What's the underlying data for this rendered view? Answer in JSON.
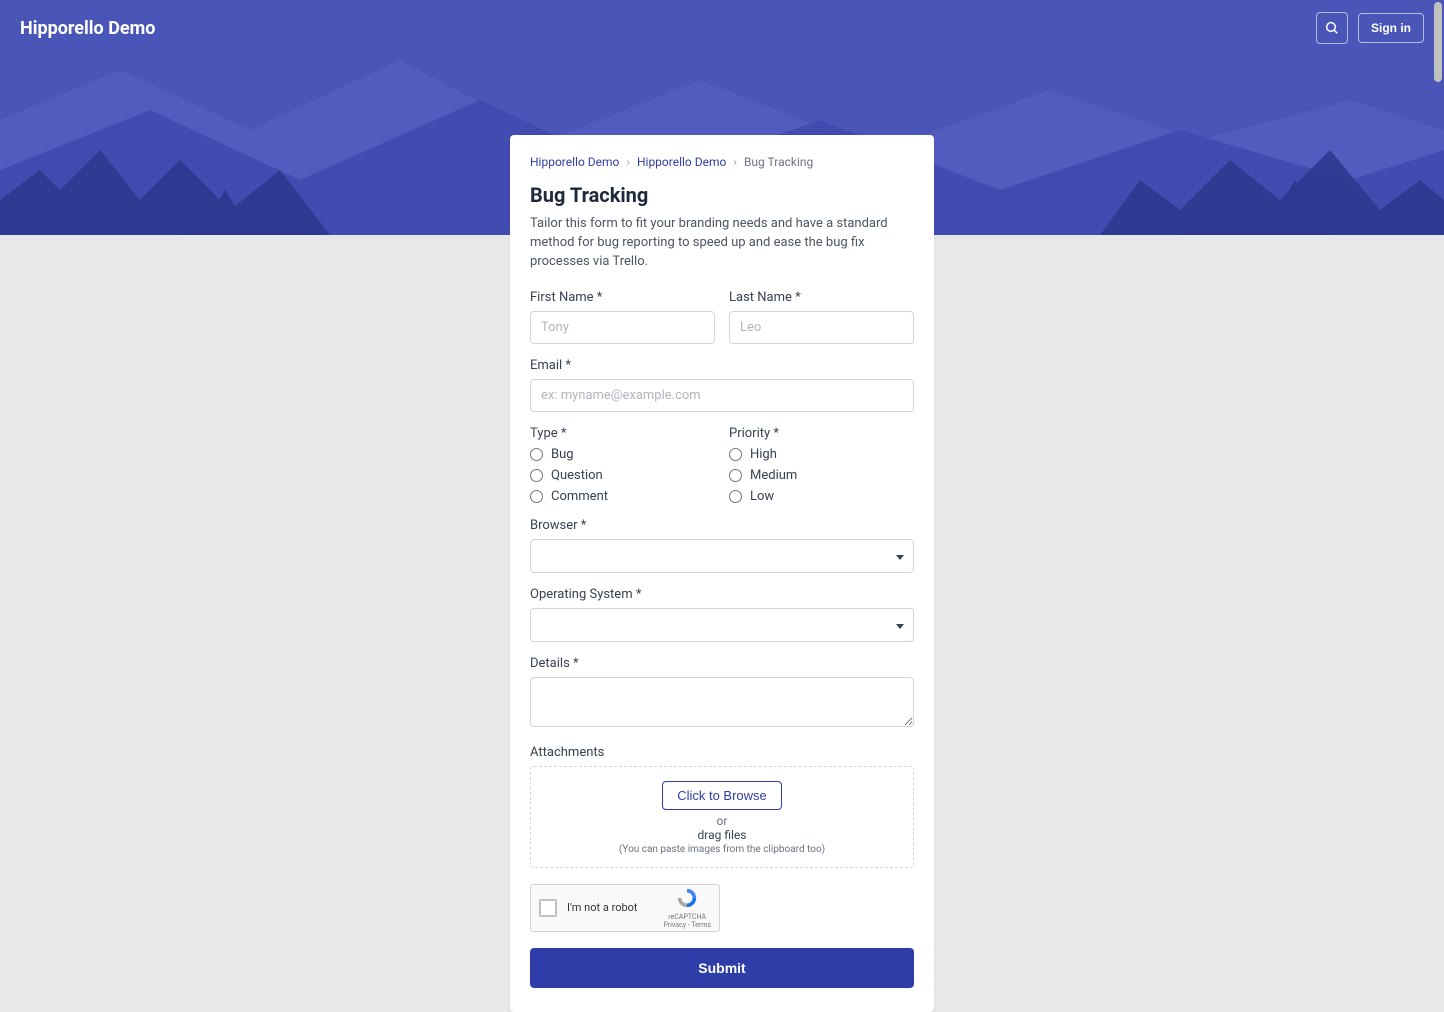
{
  "header": {
    "brand": "Hipporello Demo",
    "signin": "Sign in"
  },
  "breadcrumb": {
    "a": "Hipporello Demo",
    "b": "Hipporello Demo",
    "c": "Bug Tracking"
  },
  "form": {
    "title": "Bug Tracking",
    "description": "Tailor this form to fit your branding needs and have a standard method for bug reporting to speed up and ease the bug fix processes via Trello.",
    "first_name_label": "First Name *",
    "first_name_placeholder": "Tony",
    "last_name_label": "Last Name *",
    "last_name_placeholder": "Leo",
    "email_label": "Email *",
    "email_placeholder": "ex: myname@example.com",
    "type_label": "Type *",
    "type_options": {
      "0": "Bug",
      "1": "Question",
      "2": "Comment"
    },
    "priority_label": "Priority *",
    "priority_options": {
      "0": "High",
      "1": "Medium",
      "2": "Low"
    },
    "browser_label": "Browser *",
    "os_label": "Operating System *",
    "details_label": "Details *",
    "attachments_label": "Attachments",
    "browse_button": "Click to Browse",
    "or_text": "or",
    "drag_text": "drag files",
    "paste_hint": "(You can paste images from the clipboard too)",
    "recaptcha_label": "I'm not a robot",
    "recaptcha_brand": "reCAPTCHA",
    "recaptcha_terms": "Privacy - Terms",
    "submit": "Submit"
  }
}
